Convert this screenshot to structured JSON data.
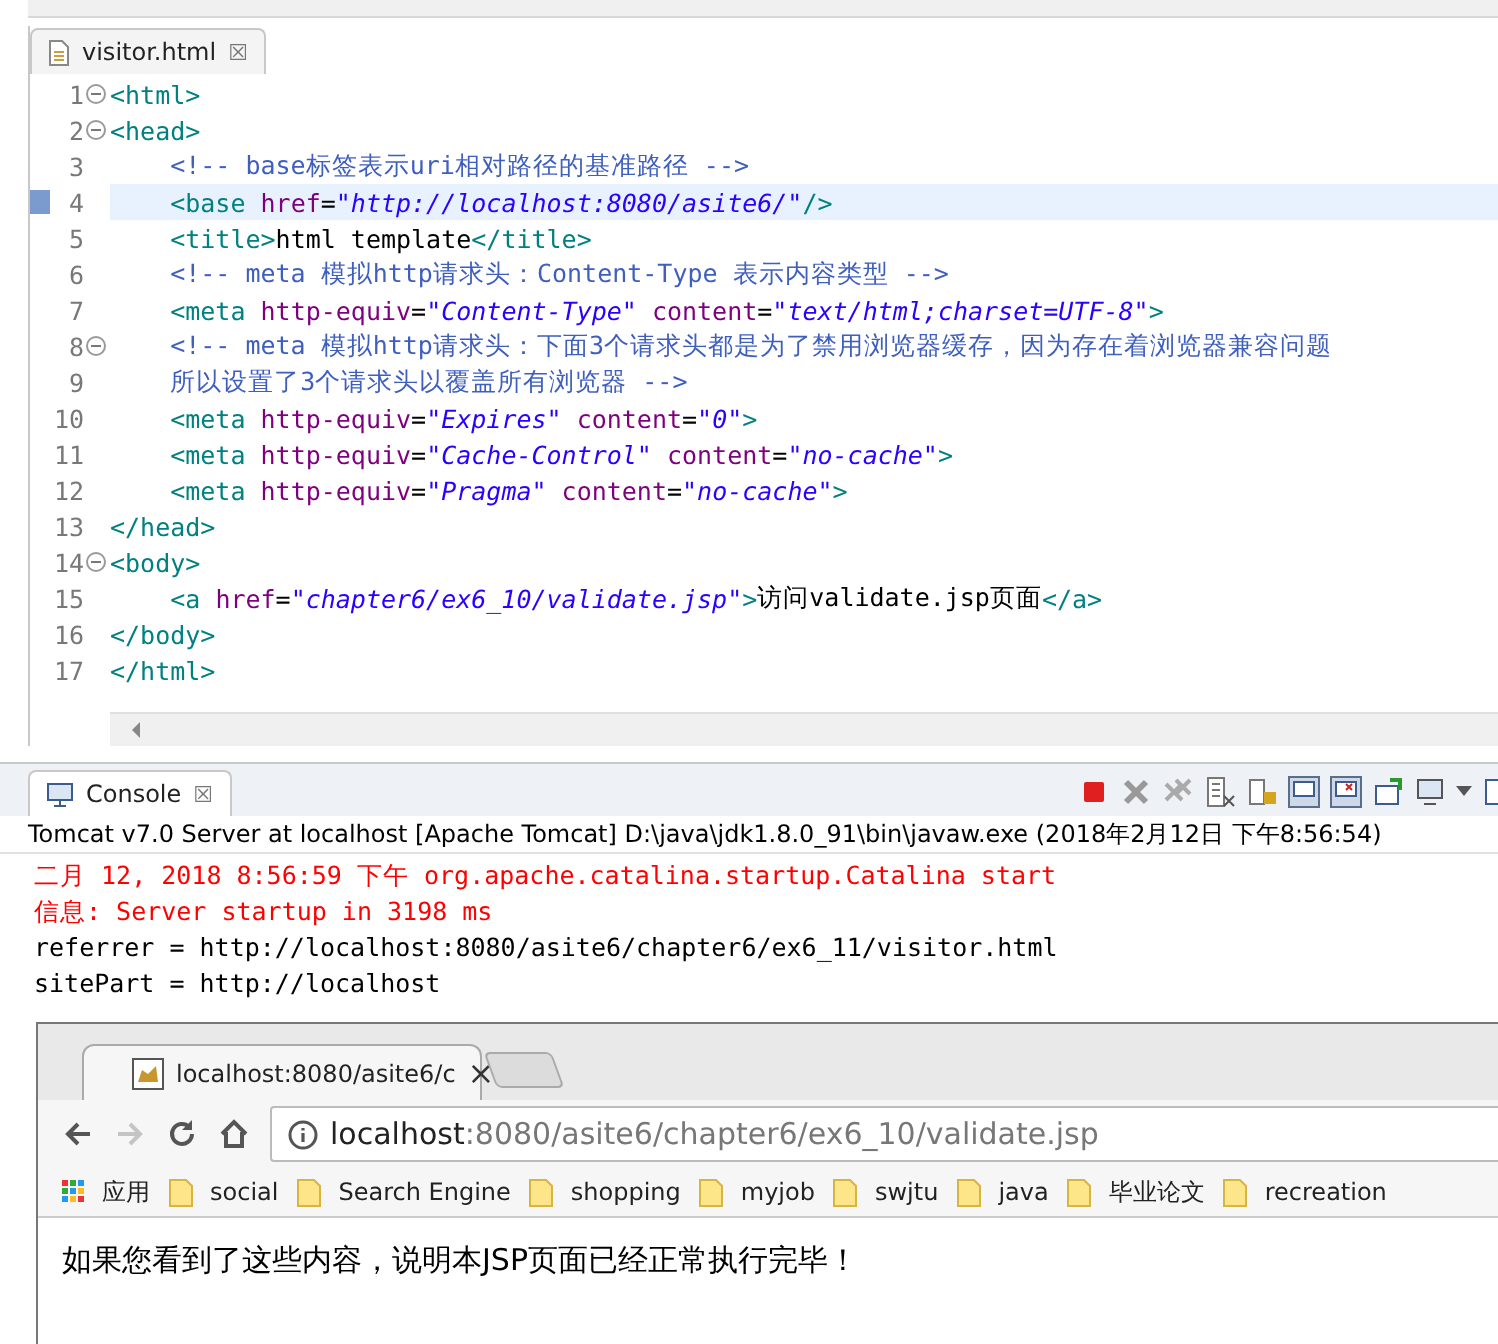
{
  "editor": {
    "tab": {
      "title": "visitor.html",
      "close": "☒"
    },
    "lines": [
      {
        "number": "1",
        "fold": true,
        "current": false,
        "tokens": [
          {
            "kind": "tag",
            "text": "<html>"
          }
        ]
      },
      {
        "number": "2",
        "fold": true,
        "current": false,
        "tokens": [
          {
            "kind": "tag",
            "text": "<head>"
          }
        ]
      },
      {
        "number": "3",
        "fold": false,
        "current": false,
        "tokens": [
          {
            "kind": "comment",
            "text": "    <!-- base标签表示uri相对路径的基准路径 -->"
          }
        ]
      },
      {
        "number": "4",
        "fold": false,
        "current": true,
        "tokens": [
          {
            "kind": "tag",
            "text": "    <base "
          },
          {
            "kind": "attr",
            "text": "href"
          },
          {
            "kind": "plain",
            "text": "="
          },
          {
            "kind": "str",
            "text": "\"http://localhost:8080/asite6/\""
          },
          {
            "kind": "tag",
            "text": "/>"
          }
        ]
      },
      {
        "number": "5",
        "fold": false,
        "current": false,
        "tokens": [
          {
            "kind": "tag",
            "text": "    <title>"
          },
          {
            "kind": "plain",
            "text": "html template"
          },
          {
            "kind": "tag",
            "text": "</title>"
          }
        ]
      },
      {
        "number": "6",
        "fold": false,
        "current": false,
        "tokens": [
          {
            "kind": "comment",
            "text": "    <!-- meta 模拟http请求头：Content-Type 表示内容类型 -->"
          }
        ]
      },
      {
        "number": "7",
        "fold": false,
        "current": false,
        "tokens": [
          {
            "kind": "tag",
            "text": "    <meta "
          },
          {
            "kind": "attr",
            "text": "http-equiv"
          },
          {
            "kind": "plain",
            "text": "="
          },
          {
            "kind": "str",
            "text": "\"Content-Type\""
          },
          {
            "kind": "attr",
            "text": " content"
          },
          {
            "kind": "plain",
            "text": "="
          },
          {
            "kind": "str",
            "text": "\"text/html;charset=UTF-8\""
          },
          {
            "kind": "tag",
            "text": ">"
          }
        ]
      },
      {
        "number": "8",
        "fold": true,
        "current": false,
        "tokens": [
          {
            "kind": "comment",
            "text": "    <!-- meta 模拟http请求头：下面3个请求头都是为了禁用浏览器缓存，因为存在着浏览器兼容问题"
          }
        ]
      },
      {
        "number": "9",
        "fold": false,
        "current": false,
        "tokens": [
          {
            "kind": "comment",
            "text": "    所以设置了3个请求头以覆盖所有浏览器 -->"
          }
        ]
      },
      {
        "number": "10",
        "fold": false,
        "current": false,
        "tokens": [
          {
            "kind": "tag",
            "text": "    <meta "
          },
          {
            "kind": "attr",
            "text": "http-equiv"
          },
          {
            "kind": "plain",
            "text": "="
          },
          {
            "kind": "str",
            "text": "\"Expires\""
          },
          {
            "kind": "attr",
            "text": " content"
          },
          {
            "kind": "plain",
            "text": "="
          },
          {
            "kind": "str",
            "text": "\"0\""
          },
          {
            "kind": "tag",
            "text": ">"
          }
        ]
      },
      {
        "number": "11",
        "fold": false,
        "current": false,
        "tokens": [
          {
            "kind": "tag",
            "text": "    <meta "
          },
          {
            "kind": "attr",
            "text": "http-equiv"
          },
          {
            "kind": "plain",
            "text": "="
          },
          {
            "kind": "str",
            "text": "\"Cache-Control\""
          },
          {
            "kind": "attr",
            "text": " content"
          },
          {
            "kind": "plain",
            "text": "="
          },
          {
            "kind": "str",
            "text": "\"no-cache\""
          },
          {
            "kind": "tag",
            "text": ">"
          }
        ]
      },
      {
        "number": "12",
        "fold": false,
        "current": false,
        "tokens": [
          {
            "kind": "tag",
            "text": "    <meta "
          },
          {
            "kind": "attr",
            "text": "http-equiv"
          },
          {
            "kind": "plain",
            "text": "="
          },
          {
            "kind": "str",
            "text": "\"Pragma\""
          },
          {
            "kind": "attr",
            "text": " content"
          },
          {
            "kind": "plain",
            "text": "="
          },
          {
            "kind": "str",
            "text": "\"no-cache\""
          },
          {
            "kind": "tag",
            "text": ">"
          }
        ]
      },
      {
        "number": "13",
        "fold": false,
        "current": false,
        "tokens": [
          {
            "kind": "tag",
            "text": "</head>"
          }
        ]
      },
      {
        "number": "14",
        "fold": true,
        "current": false,
        "tokens": [
          {
            "kind": "tag",
            "text": "<body>"
          }
        ]
      },
      {
        "number": "15",
        "fold": false,
        "current": false,
        "tokens": [
          {
            "kind": "tag",
            "text": "    <a "
          },
          {
            "kind": "attr",
            "text": "href"
          },
          {
            "kind": "plain",
            "text": "="
          },
          {
            "kind": "str",
            "text": "\"chapter6/ex6_10/validate.jsp\""
          },
          {
            "kind": "tag",
            "text": ">"
          },
          {
            "kind": "plain",
            "text": "访问validate.jsp页面"
          },
          {
            "kind": "tag",
            "text": "</a>"
          }
        ]
      },
      {
        "number": "16",
        "fold": false,
        "current": false,
        "tokens": [
          {
            "kind": "tag",
            "text": "</body>"
          }
        ]
      },
      {
        "number": "17",
        "fold": false,
        "current": false,
        "tokens": [
          {
            "kind": "tag",
            "text": "</html>"
          }
        ]
      }
    ]
  },
  "console": {
    "tab": {
      "title": "Console",
      "close": "☒"
    },
    "description": "Tomcat v7.0 Server at localhost [Apache Tomcat] D:\\java\\jdk1.8.0_91\\bin\\javaw.exe (2018年2月12日 下午8:56:54)",
    "lines": [
      {
        "kind": "error",
        "text": "二月 12, 2018 8:56:59 下午 org.apache.catalina.startup.Catalina start"
      },
      {
        "kind": "error",
        "text": "信息: Server startup in 3198 ms"
      },
      {
        "kind": "out",
        "text": "referrer = http://localhost:8080/asite6/chapter6/ex6_11/visitor.html"
      },
      {
        "kind": "out",
        "text": "sitePart = http://localhost"
      }
    ]
  },
  "browser": {
    "tab": {
      "title": "localhost:8080/asite6/c",
      "close": "×"
    },
    "forward_disabled": true,
    "address": {
      "host": "localhost",
      "path": ":8080/asite6/chapter6/ex6_10/validate.jsp"
    },
    "bookmarks": [
      {
        "kind": "apps",
        "label": "应用"
      },
      {
        "kind": "folder",
        "label": "social"
      },
      {
        "kind": "folder",
        "label": "Search Engine"
      },
      {
        "kind": "folder",
        "label": "shopping"
      },
      {
        "kind": "folder",
        "label": "myjob"
      },
      {
        "kind": "folder",
        "label": "swjtu"
      },
      {
        "kind": "folder",
        "label": "java"
      },
      {
        "kind": "folder",
        "label": "毕业论文"
      },
      {
        "kind": "folder",
        "label": "recreation"
      }
    ],
    "content": "如果您看到了这些内容，说明本JSP页面已经正常执行完毕！"
  }
}
